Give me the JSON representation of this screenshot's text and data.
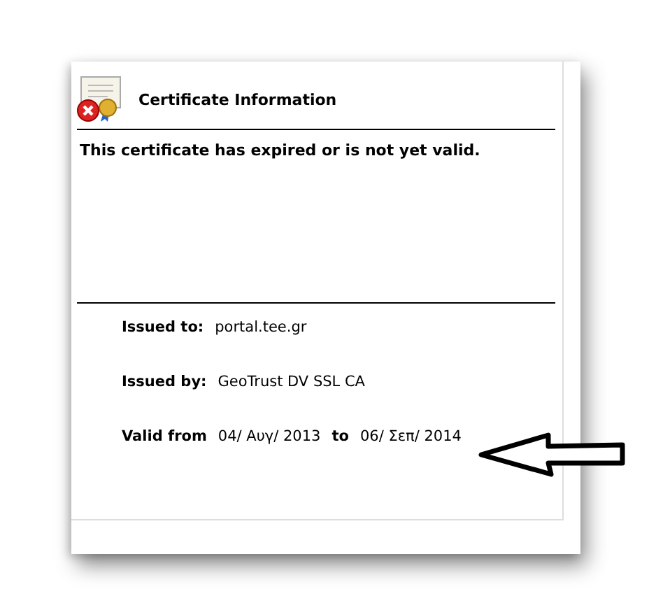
{
  "header": {
    "title": "Certificate Information"
  },
  "message": "This certificate has expired or is not yet valid.",
  "fields": [
    {
      "label": "Issued to:",
      "value": "portal.tee.gr"
    },
    {
      "label": "Issued by:",
      "value": "GeoTrust DV SSL CA"
    }
  ],
  "validity": {
    "label": "Valid from",
    "from": "04/ Αυγ/ 2013",
    "joiner": "to",
    "to": "06/ Σεπ/ 2014"
  }
}
